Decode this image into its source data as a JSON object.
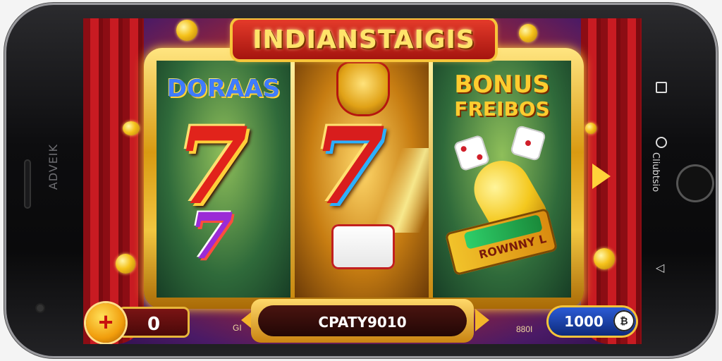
{
  "device": {
    "left_side_text": "ADVEIK",
    "right_side_text": "Cliubtsio"
  },
  "game": {
    "title": "INDIANSTAIGIS",
    "reel1_label": "DORAAS",
    "reel3_label_line1": "BONUS",
    "reel3_label_line2": "FREIBOS",
    "ticket_text": "ROWNNY L"
  },
  "controls": {
    "plus_label": "+",
    "bet_value": "0",
    "spin_label": "CPATY9010",
    "left_small_label": "GI",
    "right_small_label": "880I",
    "credit_value": "1000"
  },
  "icons": {
    "plus": "plus-icon",
    "play": "play-arrow-icon",
    "credit": "credit-coin-icon",
    "nav_recent": "square-icon",
    "nav_home": "circle-icon",
    "nav_back": "back-triangle-icon"
  },
  "colors": {
    "frame_gold": "#d99a12",
    "title_red": "#a5150f",
    "credit_blue": "#2b5bd6"
  }
}
